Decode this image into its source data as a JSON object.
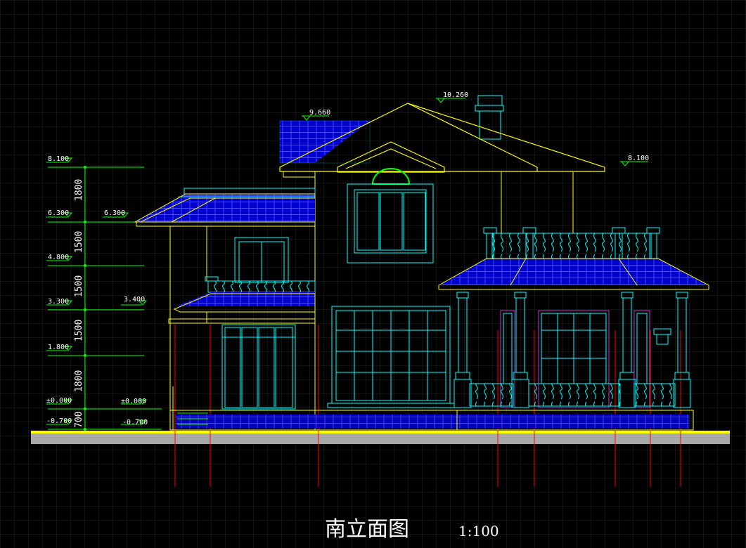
{
  "drawing": {
    "title": "南立面图",
    "scale": "1:100",
    "left_levels": [
      "8.100",
      "6.300",
      "4.800",
      "3.300",
      "1.800",
      "±0.000",
      "-0.700"
    ],
    "inner_levels": [
      "6.300",
      "3.400",
      "±0.000",
      "-0.700"
    ],
    "roof_levels": {
      "ridge_main": "10.260",
      "ridge_left": "9.660",
      "eave_right": "8.100"
    },
    "dimensions": [
      "1800",
      "1500",
      "1500",
      "1500",
      "1800",
      "700"
    ],
    "colors": {
      "background": "#000000",
      "grid": "#2a2a2a",
      "yellow": "#ffff00",
      "cyan": "#00ffff",
      "blue": "#0000ff",
      "green": "#00ff00",
      "red": "#ff0000",
      "magenta": "#cc33cc",
      "white": "#ffffff",
      "ground": "#a8a8a8"
    }
  }
}
